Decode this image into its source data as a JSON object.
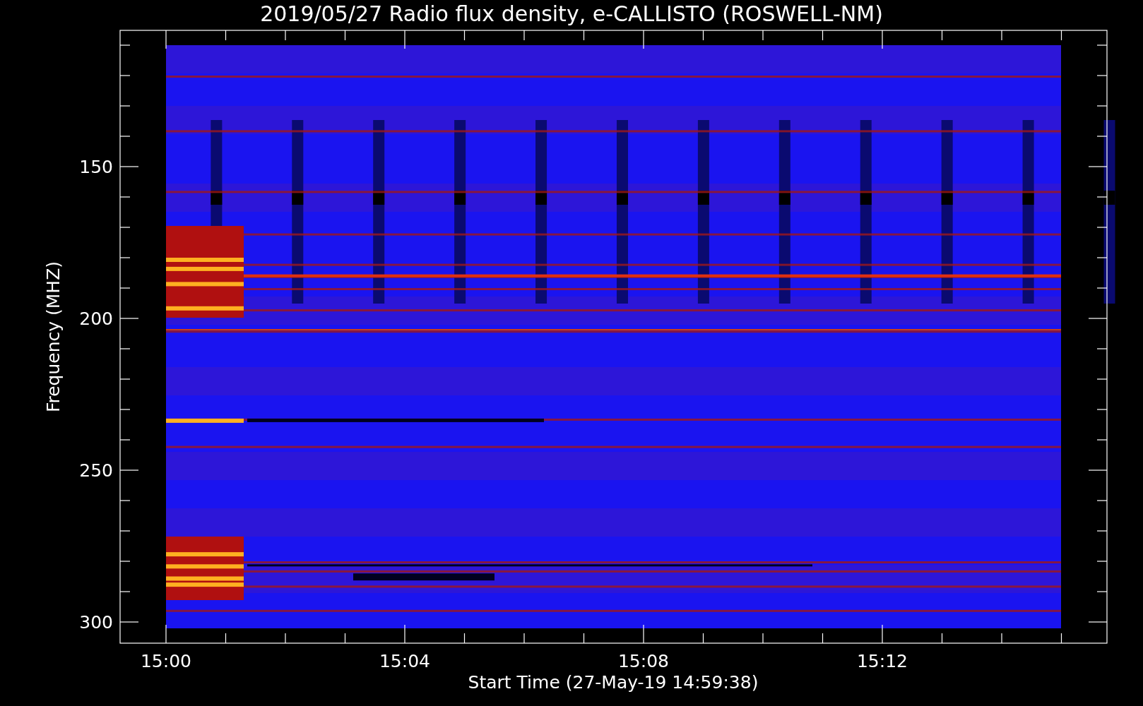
{
  "plot": {
    "title": "2019/05/27  Radio flux density, e-CALLISTO (ROSWELL-NM)",
    "ylabel": "Frequency (MHZ)",
    "xlabel": "Start Time (27-May-19 14:59:38)",
    "y_tick_labels": [
      "150",
      "200",
      "250",
      "300"
    ],
    "x_tick_labels": [
      "15:00",
      "15:04",
      "15:08",
      "15:12"
    ]
  }
}
